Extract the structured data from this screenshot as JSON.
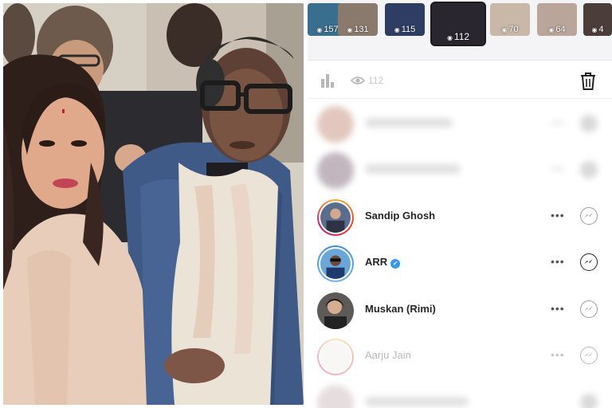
{
  "story_strip": {
    "items": [
      {
        "count": "157",
        "bg": "#3a6e8f",
        "selected": false
      },
      {
        "count": "131",
        "bg": "#8a7a6d",
        "selected": false
      },
      {
        "count": "115",
        "bg": "#2e3d63",
        "selected": false
      },
      {
        "count": "112",
        "bg": "#2a2630",
        "selected": true
      },
      {
        "count": "70",
        "bg": "#c9b7a8",
        "selected": false
      },
      {
        "count": "64",
        "bg": "#b9a59a",
        "selected": false
      },
      {
        "count": "4",
        "bg": "#4b3d3a",
        "selected": false
      }
    ]
  },
  "stats_bar": {
    "views": "112"
  },
  "viewers": [
    {
      "name": "",
      "style": "blurred"
    },
    {
      "name": "",
      "style": "blurred"
    },
    {
      "name": "Sandip Ghosh",
      "style": "normal",
      "verified": false,
      "message_dim": true
    },
    {
      "name": "ARR",
      "style": "normal",
      "verified": true,
      "message_dim": false
    },
    {
      "name": "Muskan (Rimi)",
      "style": "normal",
      "verified": false,
      "message_dim": true
    },
    {
      "name": "Aarju Jain",
      "style": "faded",
      "verified": false,
      "message_dim": true
    },
    {
      "name": "",
      "style": "blurred"
    }
  ],
  "icons": {
    "views": "eye-icon",
    "insights": "bar-chart-icon",
    "delete": "trash-icon",
    "more": "more-options-icon",
    "message": "messenger-icon",
    "verified": "verified-badge-icon"
  },
  "colors": {
    "verified": "#3897f0",
    "ring_gradient": [
      "#f5b236",
      "#e8412c",
      "#c91d77"
    ]
  }
}
